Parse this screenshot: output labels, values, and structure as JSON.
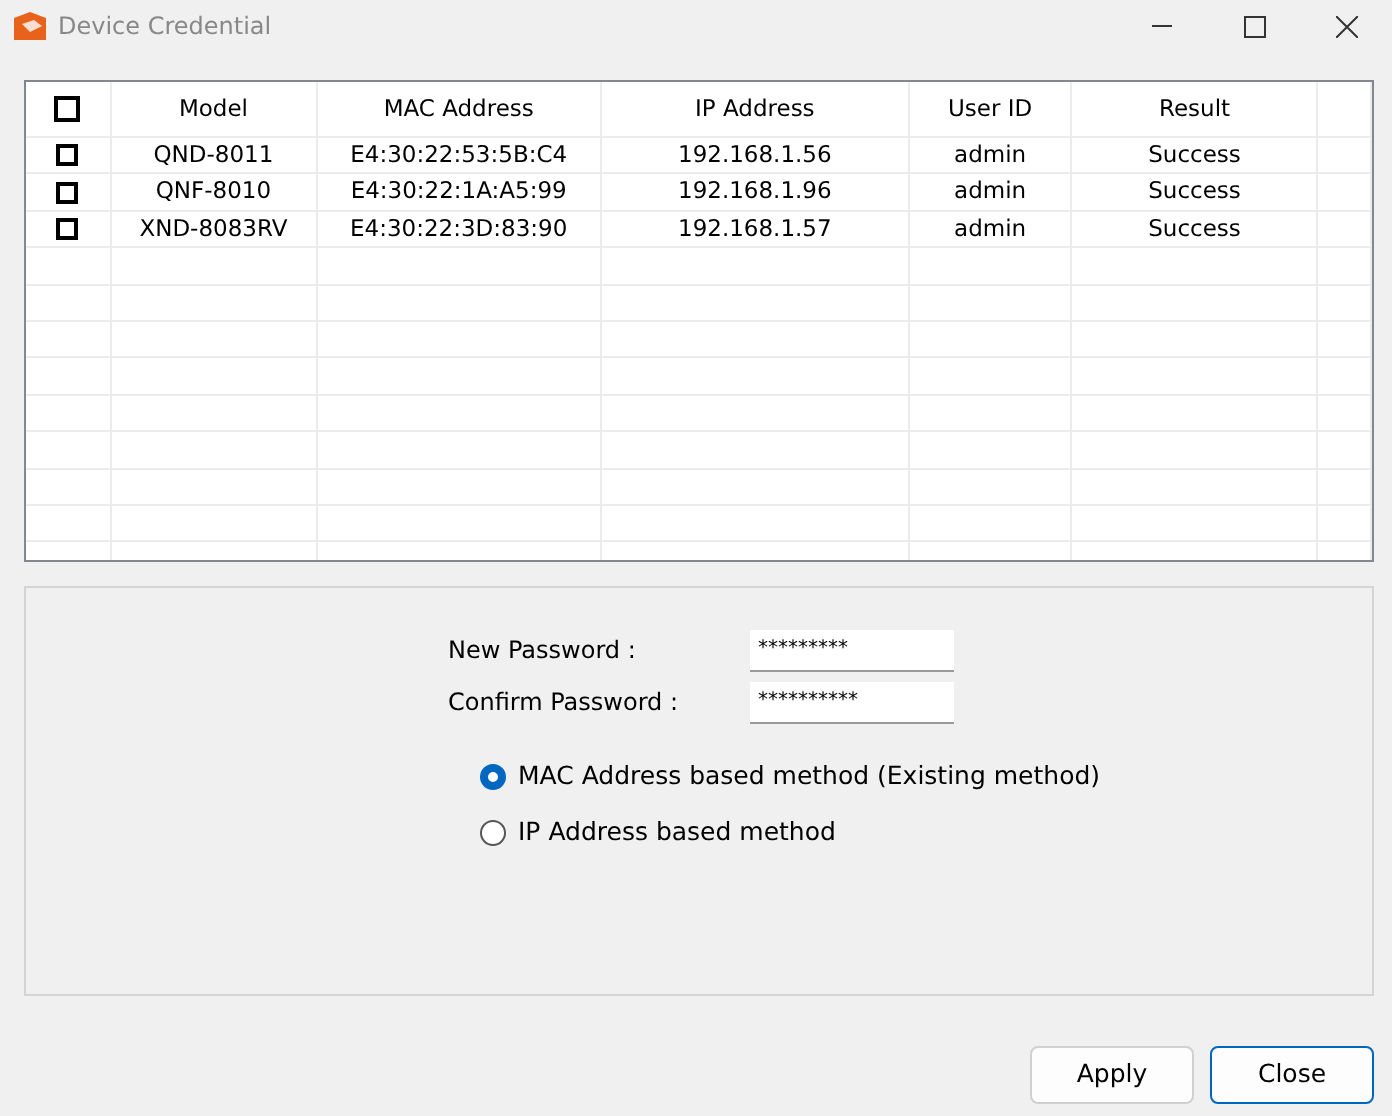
{
  "window": {
    "title": "Device Credential"
  },
  "table": {
    "header_checked": false,
    "columns": [
      "Model",
      "MAC Address",
      "IP Address",
      "User ID",
      "Result"
    ],
    "rows": [
      {
        "checked": false,
        "cells": [
          "QND-8011",
          "E4:30:22:53:5B:C4",
          "192.168.1.56",
          "admin",
          "Success"
        ]
      },
      {
        "checked": false,
        "cells": [
          "QNF-8010",
          "E4:30:22:1A:A5:99",
          "192.168.1.96",
          "admin",
          "Success"
        ]
      },
      {
        "checked": false,
        "cells": [
          "XND-8083RV",
          "E4:30:22:3D:83:90",
          "192.168.1.57",
          "admin",
          "Success"
        ]
      }
    ]
  },
  "fields": [
    {
      "label": "New Password :",
      "value": "*********"
    },
    {
      "label": "Confirm Password :",
      "value": "**********"
    }
  ],
  "methods": [
    {
      "label": "MAC Address based method (Existing method)",
      "selected": true
    },
    {
      "label": "IP Address based method",
      "selected": false
    }
  ],
  "buttons": [
    {
      "label": "Apply",
      "default": false
    },
    {
      "label": "Close",
      "default": true
    }
  ]
}
